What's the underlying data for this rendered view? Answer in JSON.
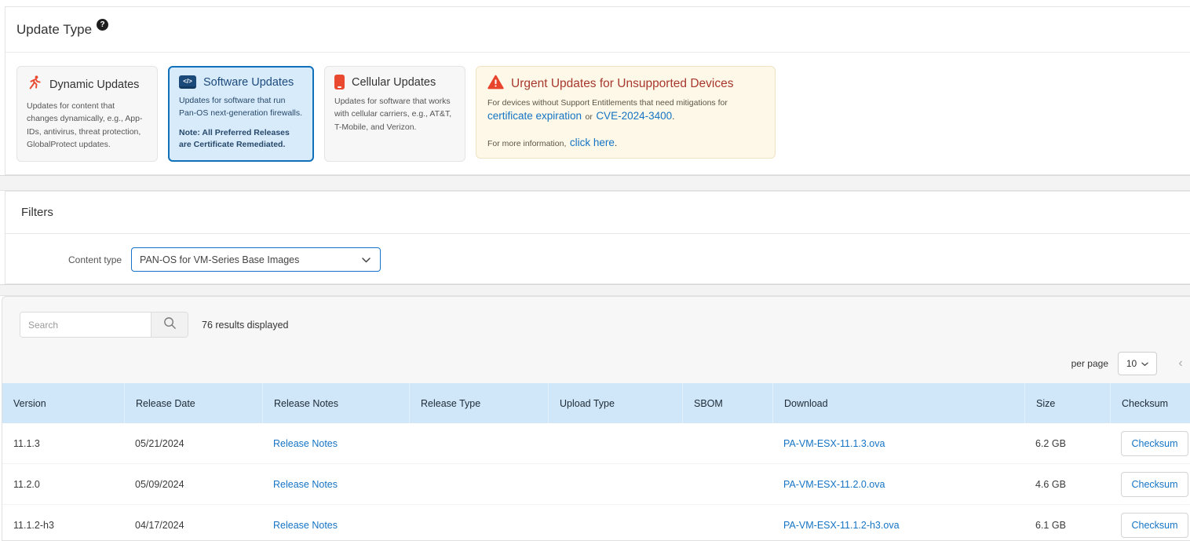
{
  "updateType": {
    "title": "Update Type",
    "cards": [
      {
        "title": "Dynamic Updates",
        "desc": "Updates for content that changes dynamically, e.g., App-IDs, antivirus, threat protection, GlobalProtect updates."
      },
      {
        "title": "Software Updates",
        "desc": "Updates for software that run Pan-OS next-generation firewalls.",
        "note": "Note: All Preferred Releases are Certificate Remediated."
      },
      {
        "title": "Cellular Updates",
        "desc": "Updates for software that works with cellular carriers, e.g., AT&T, T-Mobile, and Verizon."
      }
    ],
    "urgent": {
      "title": "Urgent Updates for Unsupported Devices",
      "line1": "For devices without Support Entitlements that need mitigations for",
      "link_cert": "certificate expiration",
      "or": "or",
      "link_cve": "CVE-2024-3400",
      "dot": ".",
      "line2": "For more information,",
      "link_more": "click here"
    }
  },
  "filters": {
    "title": "Filters",
    "contentTypeLabel": "Content type",
    "contentTypeValue": "PAN-OS for VM-Series Base Images"
  },
  "results": {
    "searchPlaceholder": "Search",
    "count": "76 results displayed",
    "perPageLabel": "per page",
    "perPageValue": "10",
    "prevChar": "‹"
  },
  "table": {
    "columns": [
      "Version",
      "Release Date",
      "Release Notes",
      "Release Type",
      "Upload Type",
      "SBOM",
      "Download",
      "Size",
      "Checksum"
    ],
    "rows": [
      {
        "version": "11.1.3",
        "date": "05/21/2024",
        "notes": "Release Notes",
        "download": "PA-VM-ESX-11.1.3.ova",
        "size": "6.2 GB",
        "checksum": "Checksum"
      },
      {
        "version": "11.2.0",
        "date": "05/09/2024",
        "notes": "Release Notes",
        "download": "PA-VM-ESX-11.2.0.ova",
        "size": "4.6 GB",
        "checksum": "Checksum"
      },
      {
        "version": "11.1.2-h3",
        "date": "04/17/2024",
        "notes": "Release Notes",
        "download": "PA-VM-ESX-11.1.2-h3.ova",
        "size": "6.1 GB",
        "checksum": "Checksum"
      }
    ]
  },
  "colors": {
    "accentBlue": "#1574c4",
    "selectedCardBorder": "#1070ba",
    "selectedCardBg": "#d8ebfa",
    "urgentTitleRed": "#a8382e",
    "warningOrange": "#e8492f",
    "tableHeaderBg": "#cfe7f9"
  }
}
